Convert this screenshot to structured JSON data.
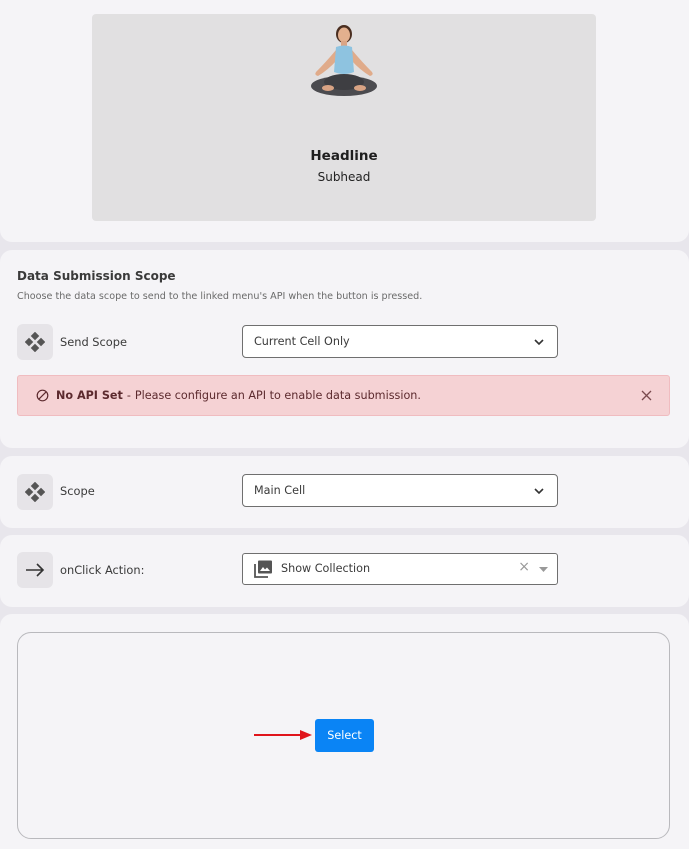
{
  "hero": {
    "image_icon": "meditating-woman-image",
    "headline": "Headline",
    "subhead": "Subhead"
  },
  "submission": {
    "title": "Data Submission Scope",
    "description": "Choose the data scope to send to the linked menu's API when the button is pressed.",
    "send_scope_label": "Send Scope",
    "send_scope_value": "Current Cell Only",
    "alert_title": "No API Set",
    "alert_separator": "-",
    "alert_message": "Please configure an API to enable data submission.",
    "alert_color": "#f5d2d4"
  },
  "scope": {
    "label": "Scope",
    "value": "Main Cell"
  },
  "action": {
    "label": "onClick Action:",
    "value": "Show Collection",
    "clear_glyph": "×"
  },
  "preview": {
    "button_label": "Select",
    "button_color": "#0a84f5",
    "arrow_color": "#e0141b"
  }
}
